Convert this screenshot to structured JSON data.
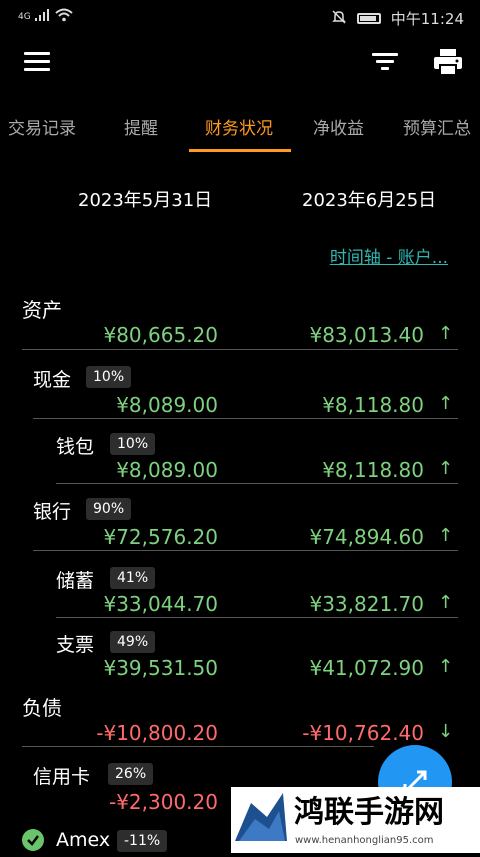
{
  "status_bar": {
    "signal": "4G",
    "time": "中午11:24"
  },
  "tabs": [
    "交易记录",
    "提醒",
    "财务状况",
    "净收益",
    "预算汇总"
  ],
  "dates": [
    "2023年5月31日",
    "2023年6月25日"
  ],
  "timeline_link": "时间轴 - 账户...",
  "sections": {
    "assets": {
      "title": "资产",
      "v1": "¥80,665.20",
      "v2": "¥83,013.40",
      "arrow": "↑"
    },
    "cash": {
      "label": "现金",
      "pct": "10%",
      "v1": "¥8,089.00",
      "v2": "¥8,118.80",
      "arrow": "↑"
    },
    "wallet": {
      "label": "钱包",
      "pct": "10%",
      "v1": "¥8,089.00",
      "v2": "¥8,118.80",
      "arrow": "↑"
    },
    "bank": {
      "label": "银行",
      "pct": "90%",
      "v1": "¥72,576.20",
      "v2": "¥74,894.60",
      "arrow": "↑"
    },
    "savings": {
      "label": "储蓄",
      "pct": "41%",
      "v1": "¥33,044.70",
      "v2": "¥33,821.70",
      "arrow": "↑"
    },
    "check": {
      "label": "支票",
      "pct": "49%",
      "v1": "¥39,531.50",
      "v2": "¥41,072.90",
      "arrow": "↑"
    },
    "liabilities": {
      "title": "负债",
      "v1": "-¥10,800.20",
      "v2": "-¥10,762.40",
      "arrow": "↓"
    },
    "credit": {
      "label": "信用卡",
      "pct": "26%",
      "v1": "-¥2,300.20"
    },
    "amex": {
      "label": "Amex",
      "pct": "-11%"
    }
  },
  "watermark": {
    "text": "鸿联手游网",
    "url": "www.henanhonglian95.com"
  },
  "colors": {
    "accent": "#ff9a1f",
    "positive": "#7ed17e",
    "negative": "#ff6a6a",
    "link": "#2fb7b0",
    "fab": "#2196f3"
  }
}
